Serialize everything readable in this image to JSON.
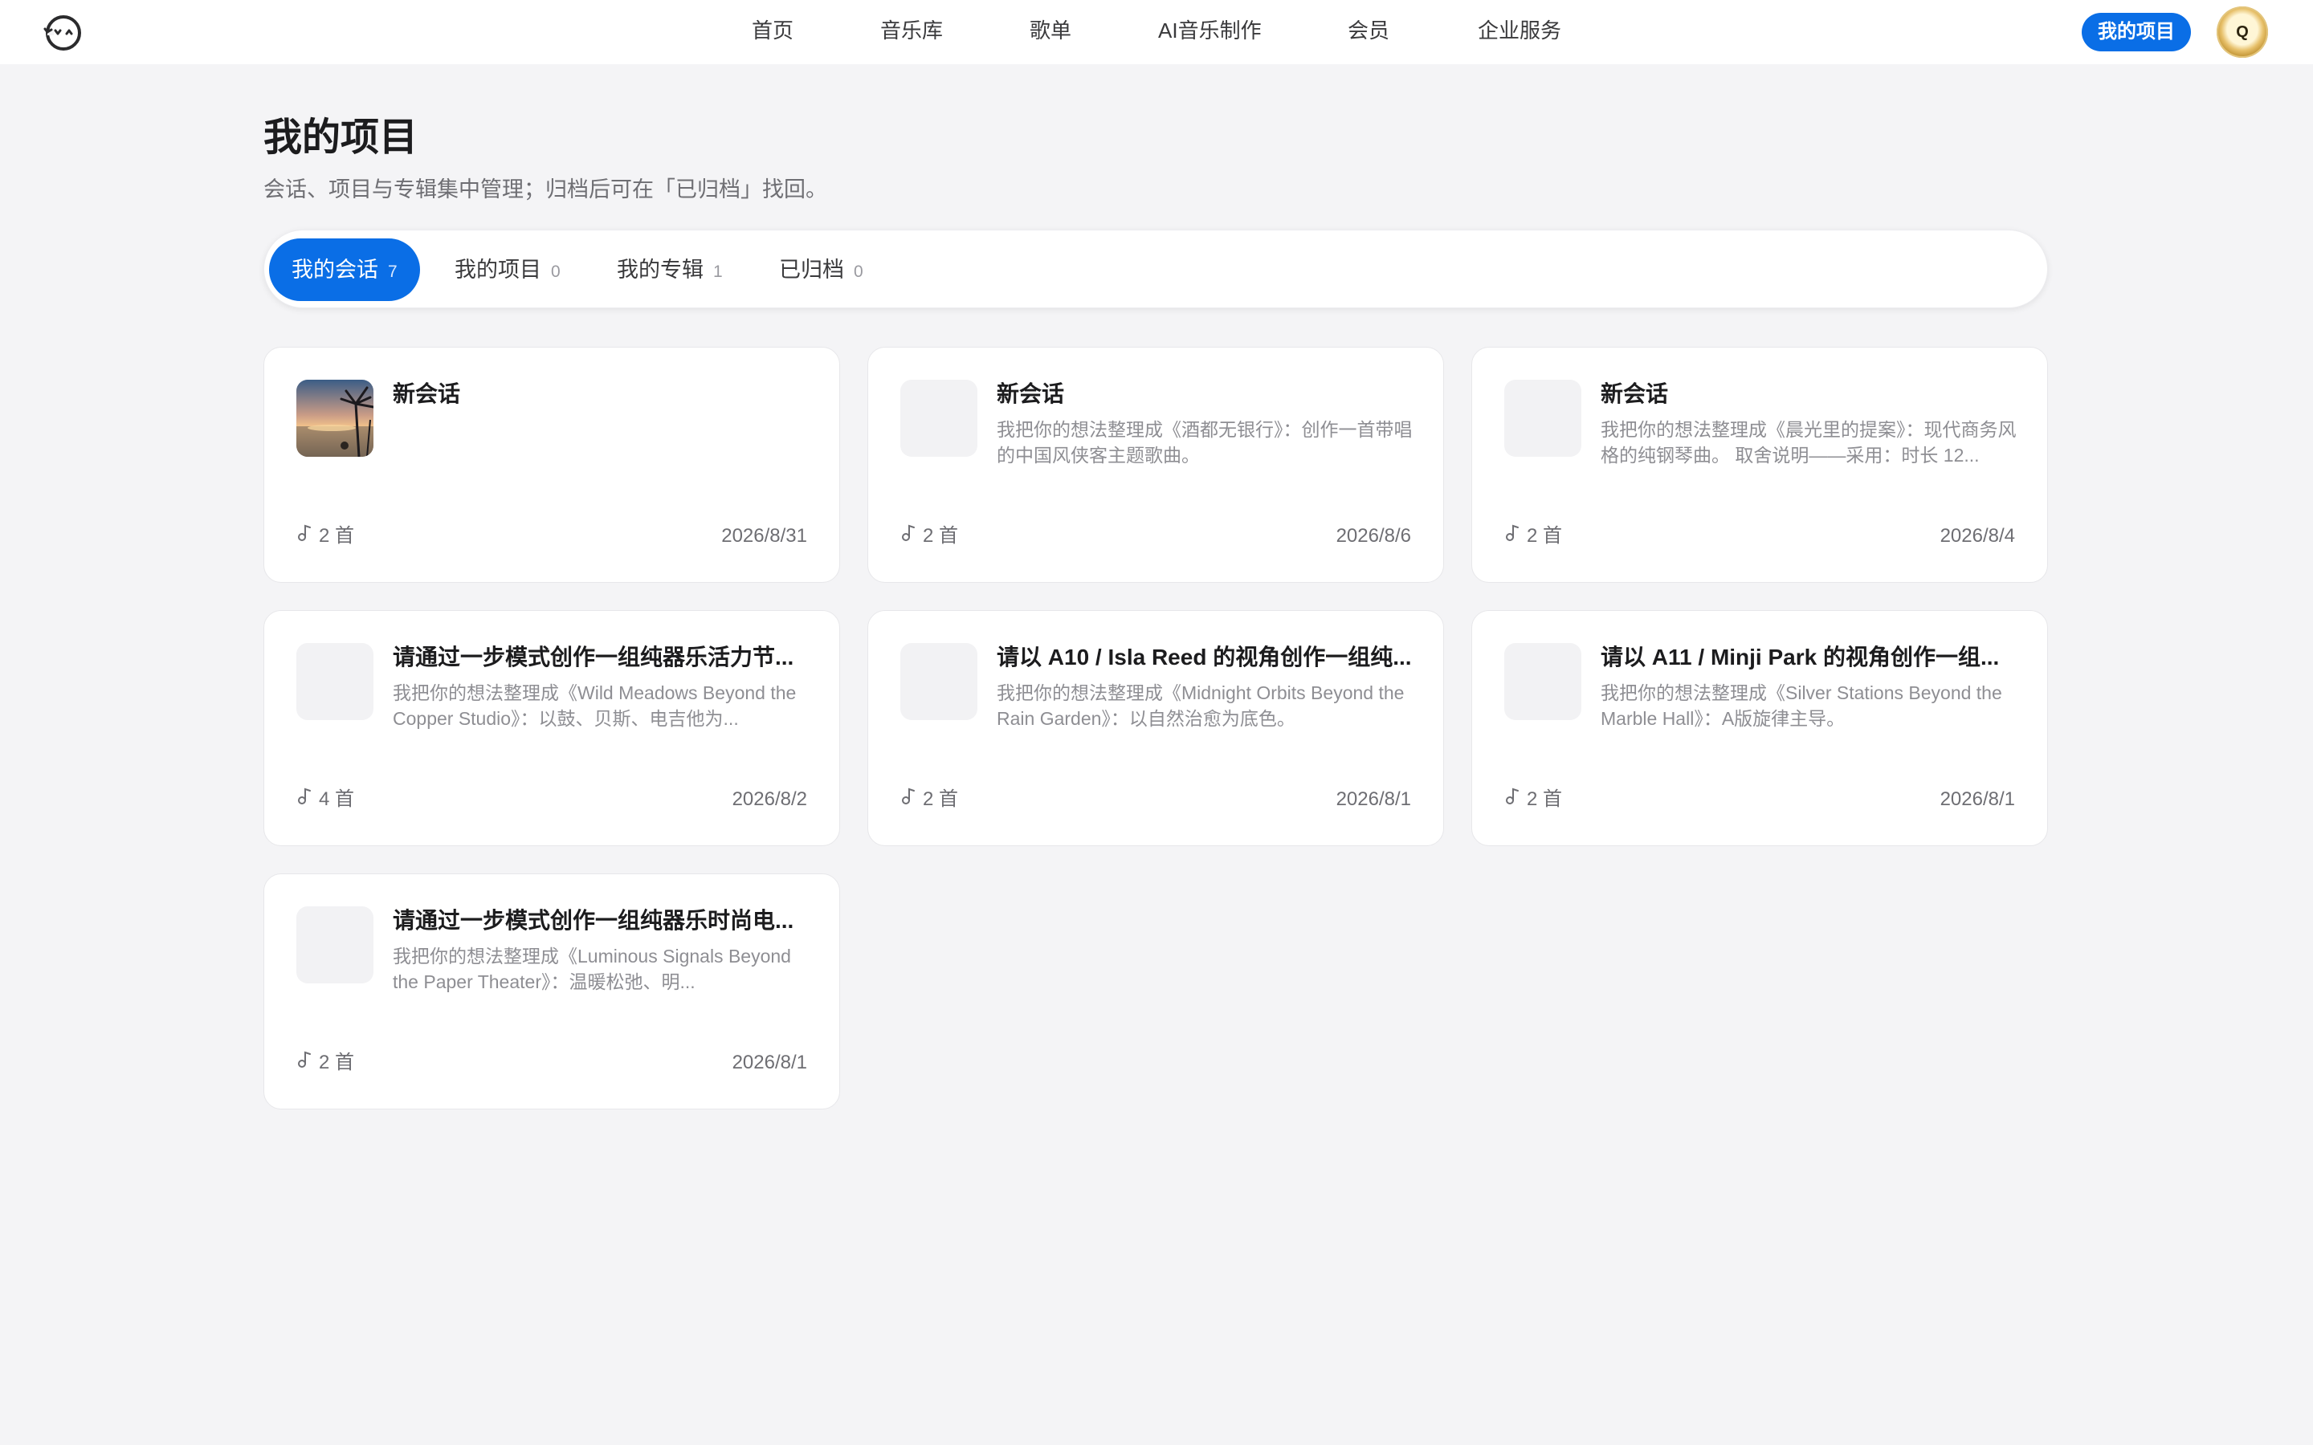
{
  "header": {
    "nav": [
      "首页",
      "音乐库",
      "歌单",
      "AI音乐制作",
      "会员",
      "企业服务"
    ],
    "my_projects_button": "我的项目",
    "avatar_letter": "Q"
  },
  "page": {
    "title": "我的项目",
    "subtitle": "会话、项目与专辑集中管理；归档后可在「已归档」找回。"
  },
  "tabs": [
    {
      "label": "我的会话",
      "count": "7",
      "active": true
    },
    {
      "label": "我的项目",
      "count": "0",
      "active": false
    },
    {
      "label": "我的专辑",
      "count": "1",
      "active": false
    },
    {
      "label": "已归档",
      "count": "0",
      "active": false
    }
  ],
  "cards": [
    {
      "title": "新会话",
      "desc": "",
      "count": "2 首",
      "date": "2026/8/31",
      "thumbnail": "beach-sunset-image"
    },
    {
      "title": "新会话",
      "desc": "我把你的想法整理成《酒都无银行》：创作一首带唱的中国风侠客主题歌曲。",
      "count": "2 首",
      "date": "2026/8/6",
      "thumbnail": "placeholder"
    },
    {
      "title": "新会话",
      "desc": "我把你的想法整理成《晨光里的提案》：现代商务风格的纯钢琴曲。 取舍说明——采用：时长 12...",
      "count": "2 首",
      "date": "2026/8/4",
      "thumbnail": "placeholder"
    },
    {
      "title": "请通过一步模式创作一组纯器乐活力节...",
      "desc": "我把你的想法整理成《Wild Meadows Beyond the Copper Studio》：以鼓、贝斯、电吉他为...",
      "count": "4 首",
      "date": "2026/8/2",
      "thumbnail": "placeholder"
    },
    {
      "title": "请以 A10 / Isla Reed 的视角创作一组纯...",
      "desc": "我把你的想法整理成《Midnight Orbits Beyond the Rain Garden》：以自然治愈为底色。",
      "count": "2 首",
      "date": "2026/8/1",
      "thumbnail": "placeholder"
    },
    {
      "title": "请以 A11 / Minji Park 的视角创作一组...",
      "desc": "我把你的想法整理成《Silver Stations Beyond the Marble Hall》：A版旋律主导。",
      "count": "2 首",
      "date": "2026/8/1",
      "thumbnail": "placeholder"
    },
    {
      "title": "请通过一步模式创作一组纯器乐时尚电...",
      "desc": "我把你的想法整理成《Luminous Signals Beyond the Paper Theater》：温暖松弛、明...",
      "count": "2 首",
      "date": "2026/8/1",
      "thumbnail": "placeholder"
    }
  ],
  "colors": {
    "accent": "#0a6ee6",
    "background": "#f4f4f6"
  },
  "icons": {
    "logo": "face-logo-icon",
    "song_count": "music-note-icon"
  }
}
